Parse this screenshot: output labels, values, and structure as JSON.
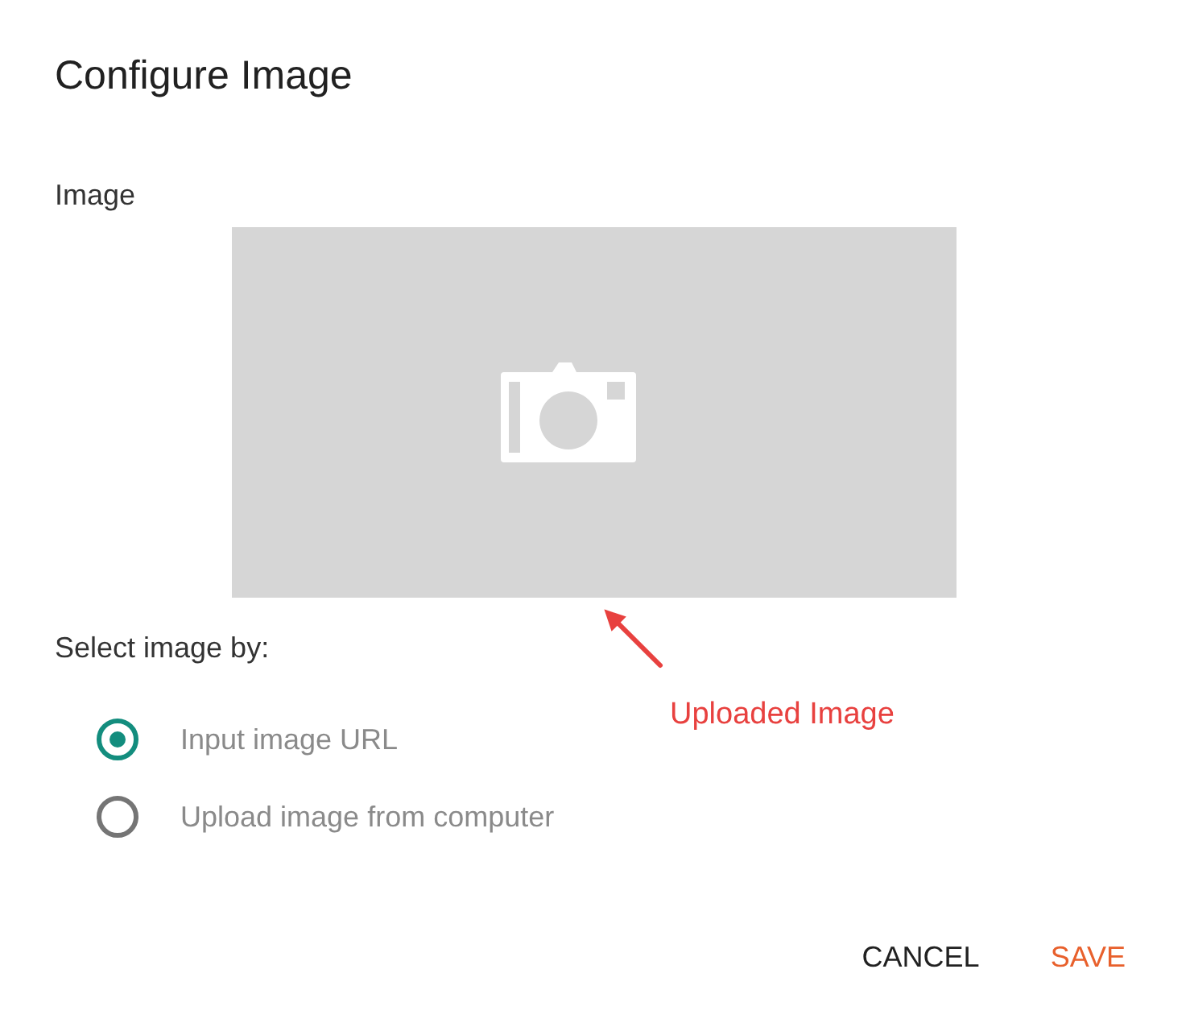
{
  "dialog": {
    "title": "Configure Image"
  },
  "image_field": {
    "label": "Image",
    "annotation": "Uploaded Image"
  },
  "source": {
    "label": "Select image by:",
    "options": [
      {
        "label": "Input image URL",
        "selected": true
      },
      {
        "label": "Upload image from computer",
        "selected": false
      }
    ]
  },
  "buttons": [
    {
      "label": "CANCEL",
      "kind": "secondary"
    },
    {
      "label": "SAVE",
      "kind": "primary"
    }
  ]
}
